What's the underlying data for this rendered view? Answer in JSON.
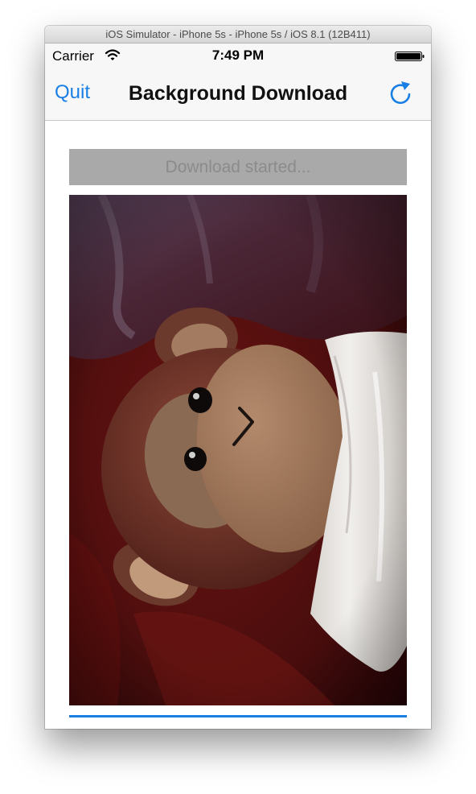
{
  "window": {
    "title": "iOS Simulator - iPhone 5s - iPhone 5s / iOS 8.1 (12B411)"
  },
  "status_bar": {
    "carrier": "Carrier",
    "time": "7:49 PM",
    "wifi_icon": "wifi-icon",
    "battery_icon": "battery-icon"
  },
  "nav": {
    "quit_label": "Quit",
    "title": "Background Download",
    "refresh_icon": "refresh-icon"
  },
  "download": {
    "status_label": "Download started..."
  },
  "image": {
    "subject": "plush monkey toy lying on red cloth beside a white tissue"
  },
  "progress": {
    "value": 1.0
  },
  "colors": {
    "tint": "#1a7fe4",
    "button_disabled": "#a9a9a9",
    "button_text_disabled": "#8b8b8b"
  }
}
